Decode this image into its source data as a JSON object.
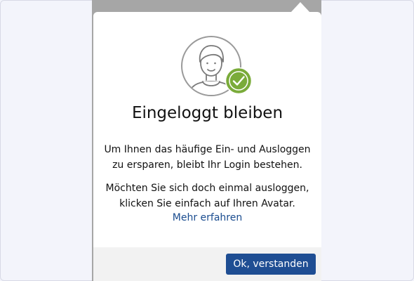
{
  "dialog": {
    "title": "Eingeloggt bleiben",
    "paragraph1": "Um Ihnen das häufige Ein- und Ausloggen zu ersparen, bleibt Ihr Login bestehen.",
    "paragraph2": "Möchten Sie sich doch einmal ausloggen, klicken Sie einfach auf Ihren Avatar.",
    "link_label": "Mehr erfahren",
    "confirm_label": "Ok, verstanden",
    "avatar_icon": "user-avatar-icon",
    "check_icon": "checkmark-badge-icon"
  },
  "colors": {
    "page_background": "#f3f4fb",
    "backdrop": "#a6a6a6",
    "popup_background": "#ffffff",
    "footer_background": "#f2f2f2",
    "primary_button": "#1f4e93",
    "link": "#1a4c8f",
    "check_badge": "#7aab3a"
  }
}
